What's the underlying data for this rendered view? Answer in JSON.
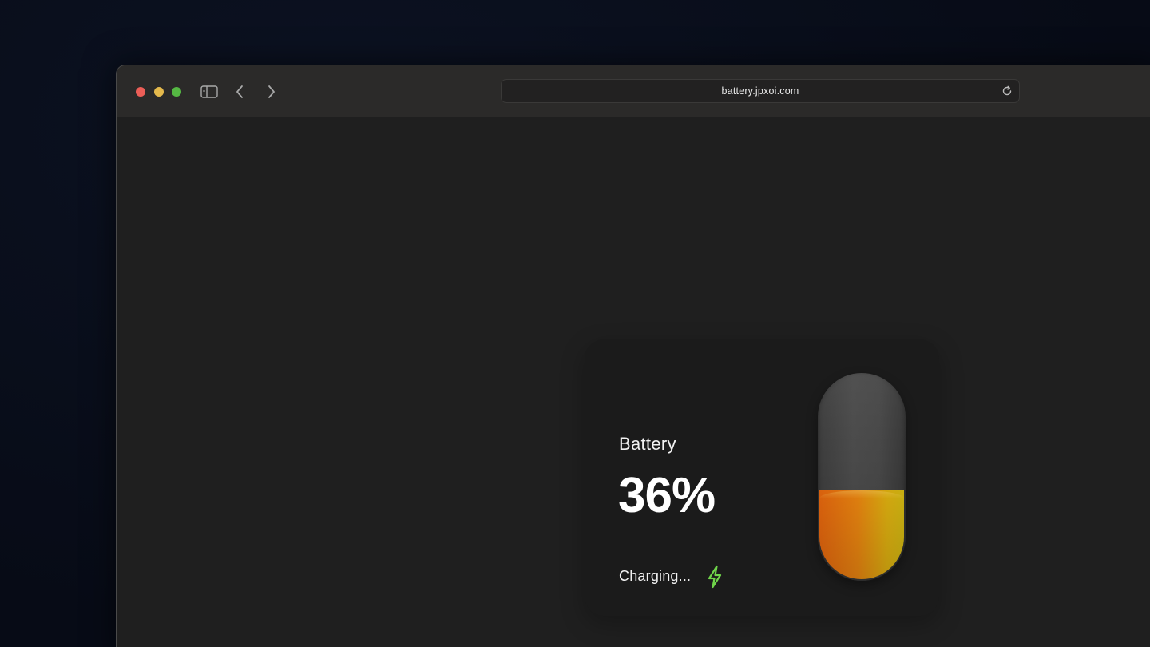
{
  "browser": {
    "url": "battery.jpxoi.com",
    "controls": {
      "close": "close-button",
      "minimize": "minimize-button",
      "maximize": "maximize-button"
    },
    "icons": [
      "sidebar-toggle-icon",
      "chevron-left-icon",
      "chevron-right-icon",
      "reload-icon"
    ]
  },
  "widget": {
    "label": "Battery",
    "level_text": "36%",
    "level_fraction": 0.36,
    "status": "Charging...",
    "status_icon": "lightning-bolt-icon",
    "colors": {
      "fill_start": "#e2650e",
      "fill_end": "#cfb512",
      "bolt": "#6fd44a"
    }
  }
}
